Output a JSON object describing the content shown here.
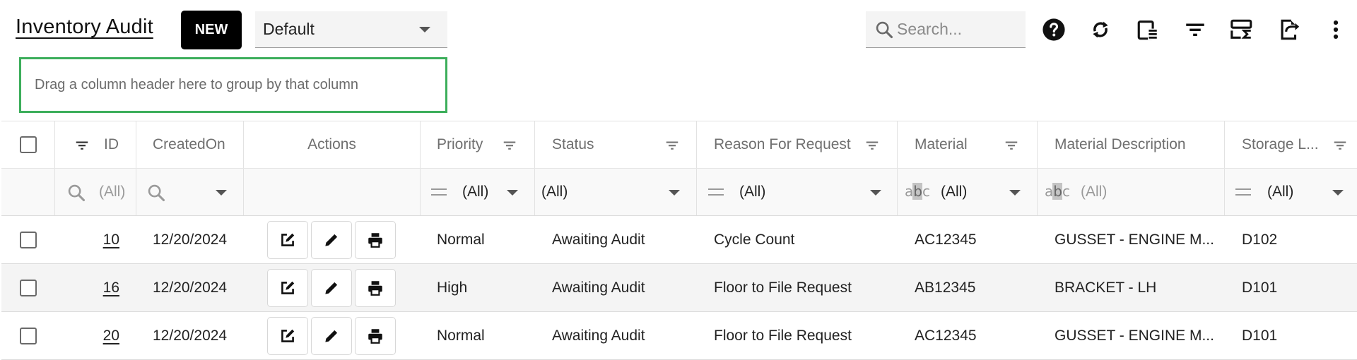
{
  "toolbar": {
    "title": "Inventory Audit",
    "new_label": "NEW",
    "view_selected": "Default",
    "search_placeholder": "Search...",
    "icons": [
      "help-icon",
      "refresh-icon",
      "column-chooser-icon",
      "filter-icon",
      "summary-icon",
      "export-icon",
      "more-icon"
    ]
  },
  "group_panel": {
    "text": "Drag a column header here to group by that column"
  },
  "grid": {
    "columns": {
      "id": "ID",
      "created_on": "CreatedOn",
      "actions": "Actions",
      "priority": "Priority",
      "status": "Status",
      "reason": "Reason For Request",
      "material": "Material",
      "material_description": "Material Description",
      "storage_location": "Storage L..."
    },
    "filters": {
      "id": "(All)",
      "priority": "(All)",
      "status": "(All)",
      "reason": "(All)",
      "material": "(All)",
      "material_description": "(All)",
      "storage_location": "(All)"
    },
    "rows": [
      {
        "id": "10",
        "created_on": "12/20/2024",
        "priority": "Normal",
        "status": "Awaiting Audit",
        "reason": "Cycle Count",
        "material": "AC12345",
        "material_description": "GUSSET - ENGINE M...",
        "storage_location": "D102"
      },
      {
        "id": "16",
        "created_on": "12/20/2024",
        "priority": "High",
        "status": "Awaiting Audit",
        "reason": "Floor to File Request",
        "material": "AB12345",
        "material_description": "BRACKET - LH",
        "storage_location": "D101"
      },
      {
        "id": "20",
        "created_on": "12/20/2024",
        "priority": "Normal",
        "status": "Awaiting Audit",
        "reason": "Floor to File Request",
        "material": "AC12345",
        "material_description": "GUSSET - ENGINE M...",
        "storage_location": "D101"
      }
    ]
  }
}
